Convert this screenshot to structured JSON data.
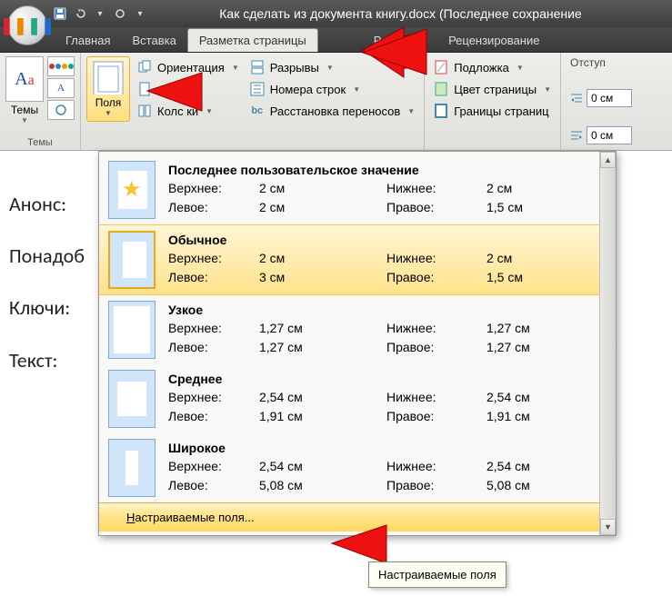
{
  "titlebar": {
    "title": "Как сделать из документа книгу.docx (Последнее сохранение"
  },
  "tabs": {
    "home": "Главная",
    "insert": "Вставка",
    "pagelayout": "Разметка страницы",
    "mailings": "Рассылки",
    "review": "Рецензирование"
  },
  "ribbon": {
    "themes": {
      "group_label": "Темы",
      "label": "Темы"
    },
    "margins": {
      "label": "Поля"
    },
    "orientation": "Ориентация",
    "size": "ер",
    "columns": "Колс    ки",
    "breaks": "Разрывы",
    "linenumbers": "Номера строк",
    "hyphenation": "Расстановка переносов",
    "watermark": "Подложка",
    "pagecolor": "Цвет страницы",
    "pageborders": "Границы страниц",
    "indent": {
      "label": "Отступ",
      "left": "0 см",
      "right": "0 см"
    }
  },
  "document": {
    "line1": "Анонс:",
    "line2": "Понадоб",
    "line3": "Ключи:",
    "line4": "Текст:"
  },
  "dropdown": {
    "presets": [
      {
        "title": "Последнее пользовательское значение",
        "top_l": "Верхнее:",
        "top_v": "2 см",
        "bot_l": "Нижнее:",
        "bot_v": "2 см",
        "left_l": "Левое:",
        "left_v": "2 см",
        "right_l": "Правое:",
        "right_v": "1,5 см",
        "star": true,
        "selected": false,
        "m": {
          "t": 10,
          "b": 10,
          "l": 10,
          "r": 8
        }
      },
      {
        "title": "Обычное",
        "top_l": "Верхнее:",
        "top_v": "2 см",
        "bot_l": "Нижнее:",
        "bot_v": "2 см",
        "left_l": "Левое:",
        "left_v": "3 см",
        "right_l": "Правое:",
        "right_v": "1,5 см",
        "star": false,
        "selected": true,
        "m": {
          "t": 10,
          "b": 10,
          "l": 14,
          "r": 8
        }
      },
      {
        "title": "Узкое",
        "top_l": "Верхнее:",
        "top_v": "1,27 см",
        "bot_l": "Нижнее:",
        "bot_v": "1,27 см",
        "left_l": "Левое:",
        "left_v": "1,27 см",
        "right_l": "Правое:",
        "right_v": "1,27 см",
        "star": false,
        "selected": false,
        "m": {
          "t": 5,
          "b": 5,
          "l": 5,
          "r": 5
        }
      },
      {
        "title": "Среднее",
        "top_l": "Верхнее:",
        "top_v": "2,54 см",
        "bot_l": "Нижнее:",
        "bot_v": "2,54 см",
        "left_l": "Левое:",
        "left_v": "1,91 см",
        "right_l": "Правое:",
        "right_v": "1,91 см",
        "star": false,
        "selected": false,
        "m": {
          "t": 12,
          "b": 12,
          "l": 9,
          "r": 9
        }
      },
      {
        "title": "Широкое",
        "top_l": "Верхнее:",
        "top_v": "2,54 см",
        "bot_l": "Нижнее:",
        "bot_v": "2,54 см",
        "left_l": "Левое:",
        "left_v": "5,08 см",
        "right_l": "Правое:",
        "right_v": "5,08 см",
        "star": false,
        "selected": false,
        "m": {
          "t": 12,
          "b": 12,
          "l": 18,
          "r": 18
        }
      }
    ],
    "custom": "Настраиваемые поля..."
  },
  "tooltip": {
    "text": "Настраиваемые поля"
  }
}
